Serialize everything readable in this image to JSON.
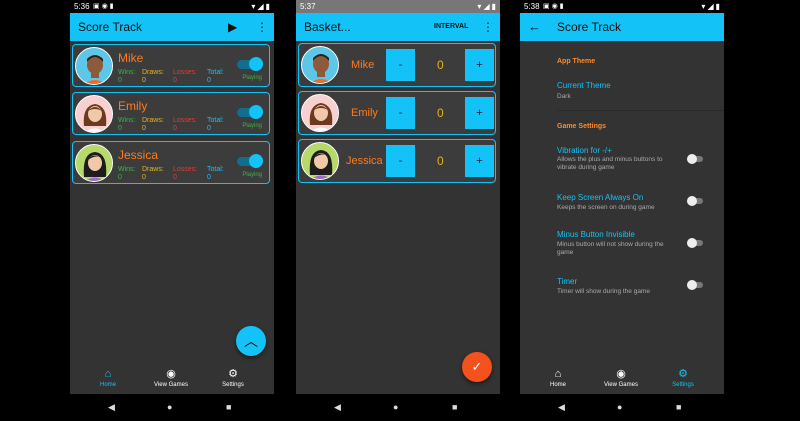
{
  "phone1": {
    "status_time": "5:36",
    "title": "Score Track",
    "players": [
      {
        "name": "Mike",
        "wins_label": "Wins:",
        "wins": "0",
        "draws_label": "Draws:",
        "draws": "0",
        "losses_label": "Losses:",
        "losses": "0",
        "total_label": "Total:",
        "total": "0",
        "status": "Playing"
      },
      {
        "name": "Emily",
        "wins_label": "Wins:",
        "wins": "0",
        "draws_label": "Draws:",
        "draws": "0",
        "losses_label": "Losses:",
        "losses": "0",
        "total_label": "Total:",
        "total": "0",
        "status": "Playing"
      },
      {
        "name": "Jessica",
        "wins_label": "Wins:",
        "wins": "0",
        "draws_label": "Draws:",
        "draws": "0",
        "losses_label": "Losses:",
        "losses": "0",
        "total_label": "Total:",
        "total": "0",
        "status": "Playing"
      }
    ],
    "nav": {
      "home": "Home",
      "view_games": "View Games",
      "settings": "Settings"
    }
  },
  "phone2": {
    "status_time": "5:37",
    "title": "Basket...",
    "interval_label": "INTERVAL",
    "players": [
      {
        "name": "Mike",
        "minus": "-",
        "score": "0",
        "plus": "+"
      },
      {
        "name": "Emily",
        "minus": "-",
        "score": "0",
        "plus": "+"
      },
      {
        "name": "Jessica",
        "minus": "-",
        "score": "0",
        "plus": "+"
      }
    ]
  },
  "phone3": {
    "status_time": "5:38",
    "title": "Score Track",
    "app_theme_header": "App Theme",
    "current_theme_title": "Current Theme",
    "current_theme_value": "Dark",
    "game_settings_header": "Game Settings",
    "vibration_title": "Vibration for -/+",
    "vibration_desc": "Allows the plus and minus buttons to vibrate during game",
    "keep_screen_title": "Keep Screen Always On",
    "keep_screen_desc": "Keeps the screen on during game",
    "minus_invisible_title": "Minus Button Invisible",
    "minus_invisible_desc": "Minus button will not show during the game",
    "timer_title": "Timer",
    "timer_desc": "Timer will show during the game",
    "nav": {
      "home": "Home",
      "view_games": "View Games",
      "settings": "Settings"
    }
  },
  "colors": {
    "accent": "#13c3f7",
    "name_orange": "#ff7b1c",
    "wins_green": "#3bb34a",
    "losses_red": "#e53935",
    "score_yellow": "#e2b71a",
    "fab_orange": "#f4511e"
  },
  "icons": [
    "play-icon",
    "more-vert-icon",
    "back-arrow-icon",
    "home-icon",
    "eye-icon",
    "gear-icon",
    "chevron-up-icon",
    "check-icon"
  ]
}
